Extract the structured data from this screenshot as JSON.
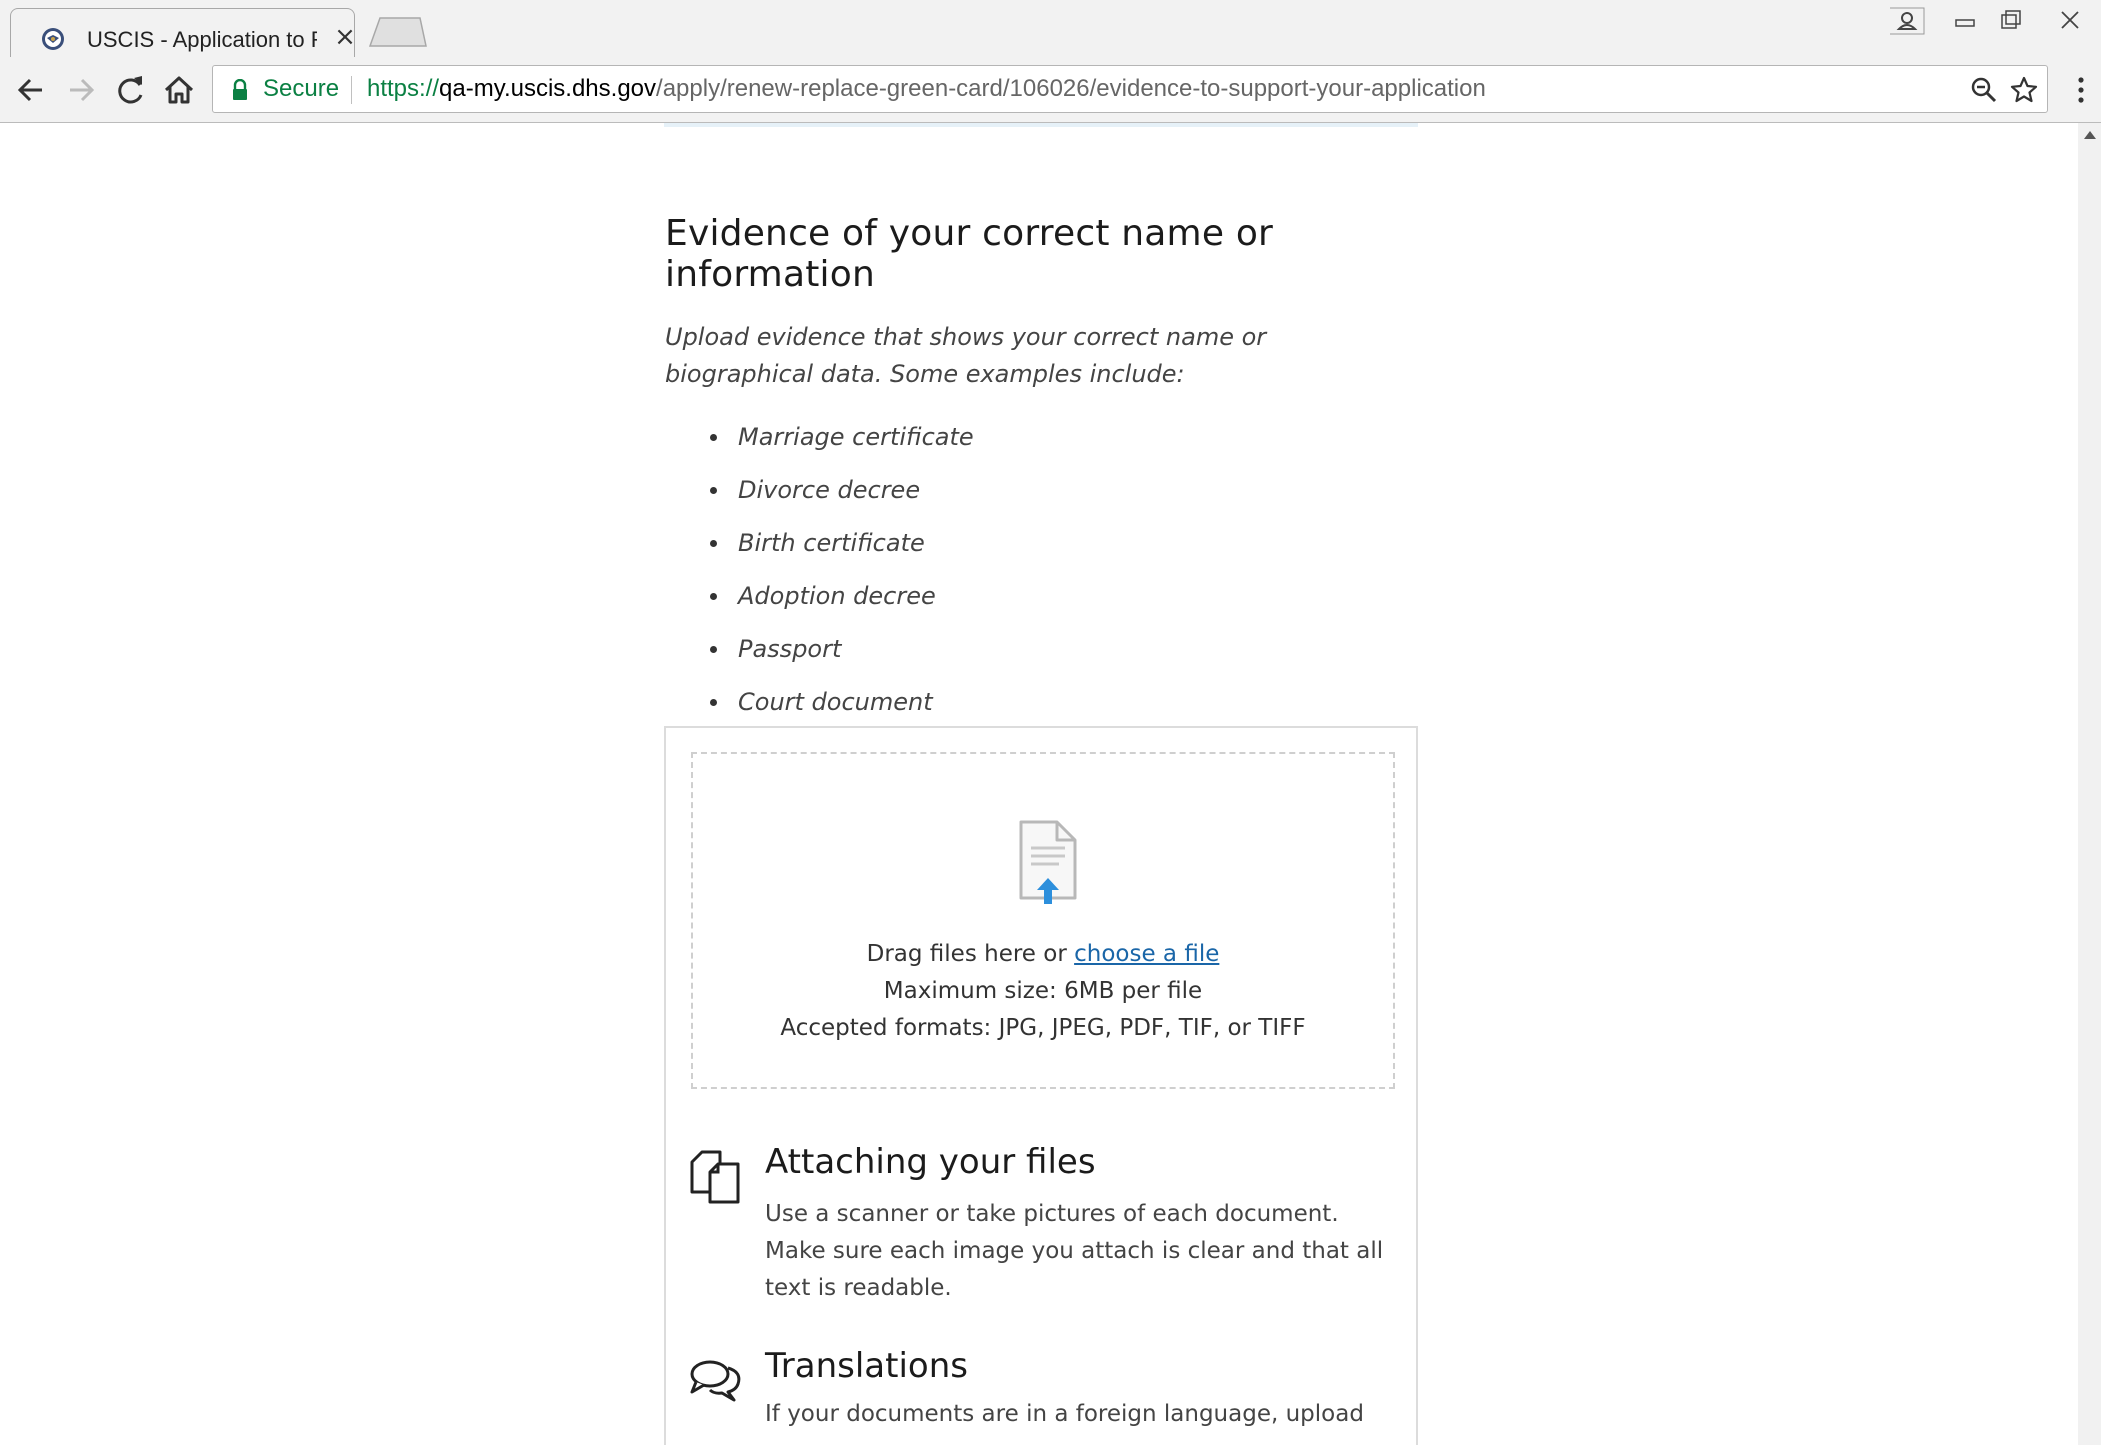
{
  "browser": {
    "tab": {
      "title": "USCIS - Application to Re",
      "close_label": "×"
    },
    "toolbar": {
      "secure_label": "Secure",
      "url_scheme": "https://",
      "url_host": "qa-my.uscis.dhs.gov",
      "url_path": "/apply/renew-replace-green-card/106026/evidence-to-support-your-application"
    },
    "icons": {
      "back": "back-arrow-icon",
      "forward": "forward-arrow-icon",
      "reload": "reload-icon",
      "home": "home-icon",
      "lock": "lock-icon",
      "zoom": "zoom-icon",
      "bookmark": "star-icon",
      "menu": "kebab-menu-icon"
    }
  },
  "page": {
    "section_title": "Evidence of your correct name or information",
    "intro": "Upload evidence that shows your correct name or biographical data. Some examples include:",
    "examples": [
      "Marriage certificate",
      "Divorce decree",
      "Birth certificate",
      "Adoption decree",
      "Passport",
      "Court document"
    ],
    "upload": {
      "drag_text": "Drag files here or ",
      "choose_link": "choose a file",
      "max_size": "Maximum size: 6MB per file",
      "formats": "Accepted formats: JPG, JPEG, PDF, TIF, or TIFF"
    },
    "attaching": {
      "title": "Attaching your files",
      "body": "Use a scanner or take pictures of each document. Make sure each image you attach is clear and that all text is readable."
    },
    "translations": {
      "title": "Translations",
      "body": "If your documents are in a foreign language, upload an"
    }
  },
  "colors": {
    "secure_green": "#0b8043",
    "link_blue": "#1a66a8",
    "upload_arrow": "#2d8fdc"
  }
}
